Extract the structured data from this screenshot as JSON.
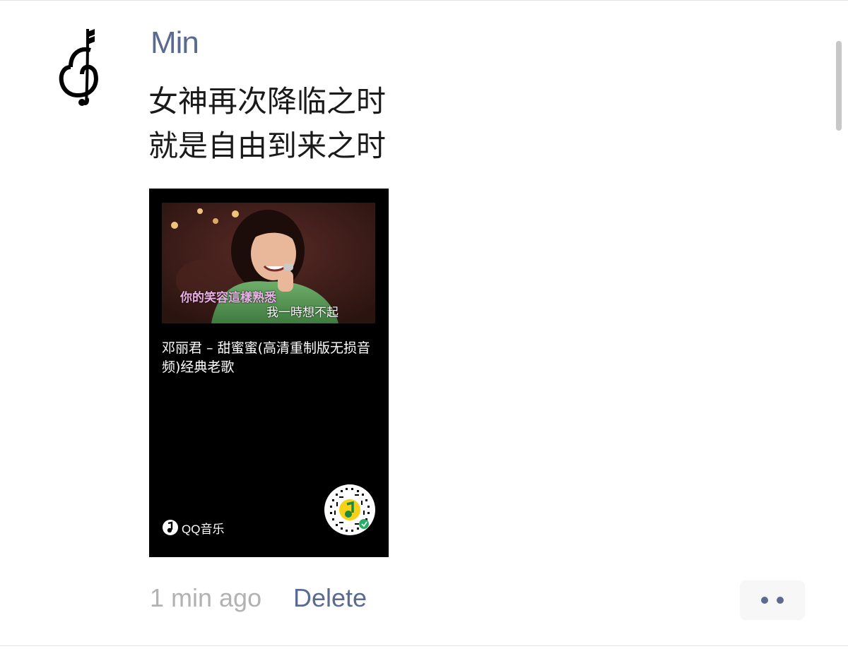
{
  "post": {
    "author": "Min",
    "lines": [
      "女神再次降临之时",
      "就是自由到来之时"
    ]
  },
  "card": {
    "cover": {
      "subtitle_line_1": "你的笑容這樣熟悉",
      "subtitle_line_2": "我一時想不起"
    },
    "title": "邓丽君 – 甜蜜蜜(高清重制版无损音频)经典老歌",
    "brand": "QQ音乐"
  },
  "footer": {
    "timestamp": "1 min ago",
    "delete_label": "Delete"
  },
  "colors": {
    "link": "#5b6a91",
    "timestamp": "#b2b2b2",
    "card_background": "#000000"
  },
  "icons": {
    "avatar": "treble-clef-monogram-icon",
    "brand": "qq-music-logo-icon",
    "qr": "mini-program-code-icon",
    "more": "more-dots-icon"
  }
}
